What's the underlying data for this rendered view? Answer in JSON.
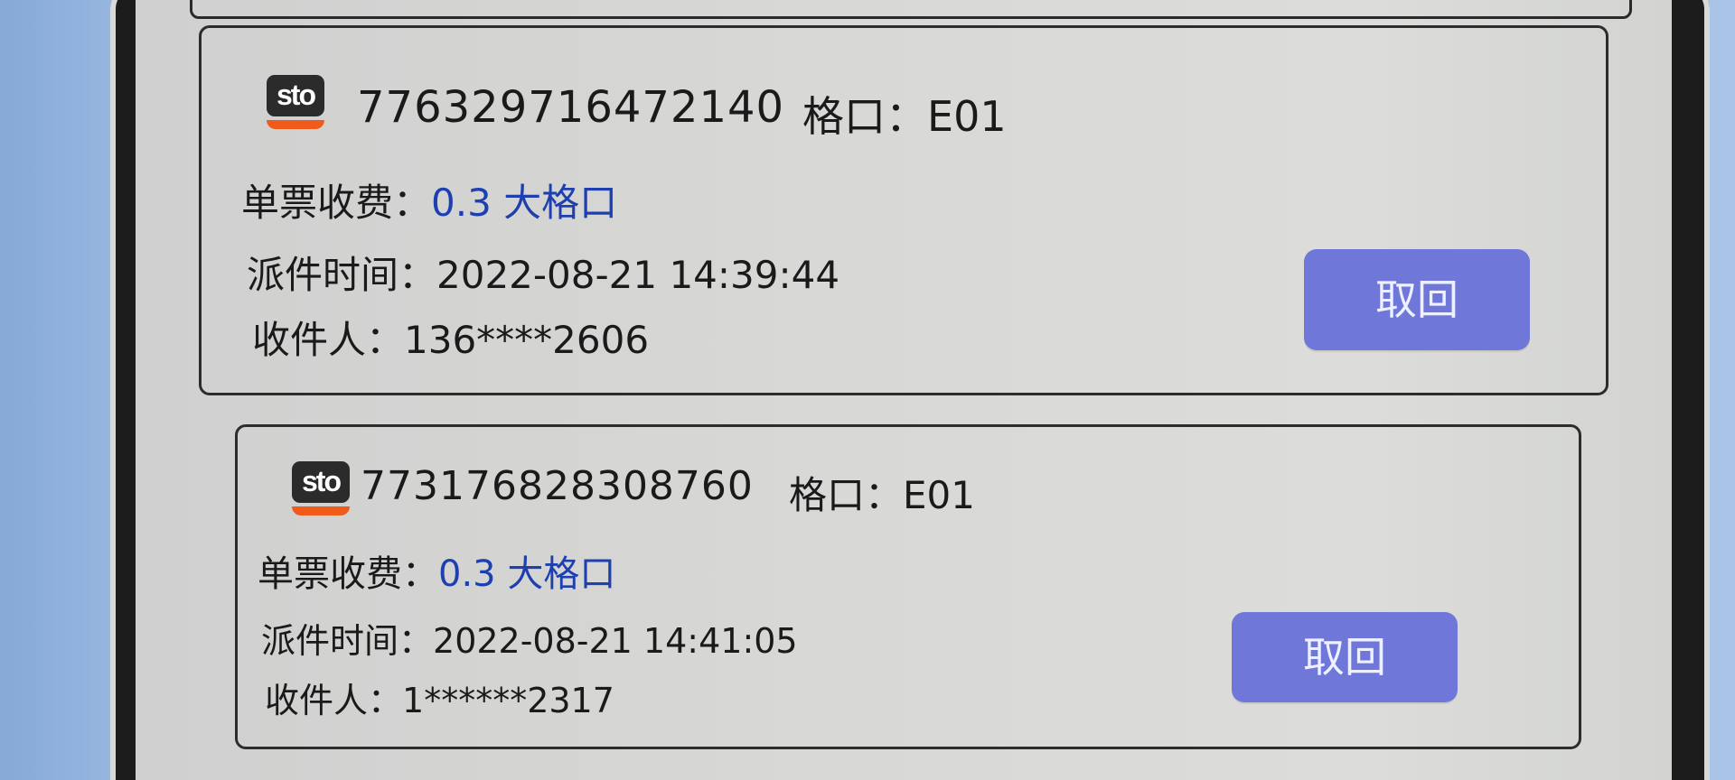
{
  "parcels": [
    {
      "carrier_logo": "sto",
      "tracking_no": "776329716472140",
      "slot_label": "格口：",
      "slot_value": "E01",
      "fee_label": "单票收费：",
      "fee_value": "0.3 大格口",
      "time_label": "派件时间：",
      "time_value": "2022-08-21 14:39:44",
      "recipient_label": "收件人：",
      "recipient_value": "136****2606",
      "action_label": "取回"
    },
    {
      "carrier_logo": "sto",
      "tracking_no": "773176828308760",
      "slot_label": "格口：",
      "slot_value": "E01",
      "fee_label": "单票收费：",
      "fee_value": "0.3 大格口",
      "time_label": "派件时间：",
      "time_value": "2022-08-21 14:41:05",
      "recipient_label": "收件人：",
      "recipient_value": "1******2317",
      "action_label": "取回"
    }
  ],
  "colors": {
    "fee_text": "#1d3fb0",
    "button_bg": "#6f77d8",
    "logo_accent": "#f05a1a"
  }
}
